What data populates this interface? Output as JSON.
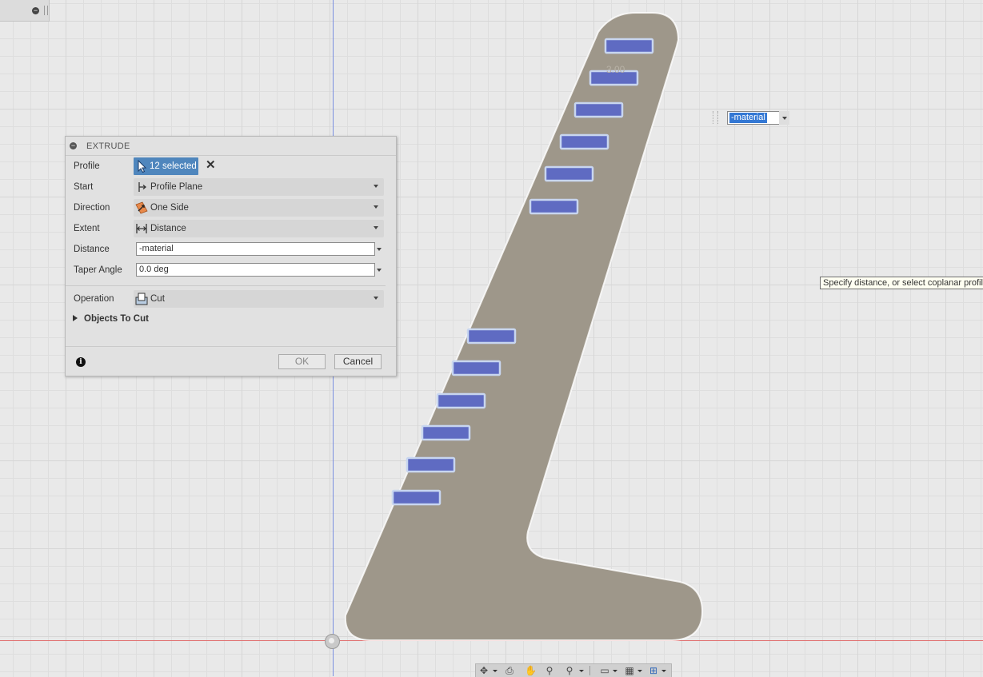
{
  "dialog": {
    "title": "EXTRUDE",
    "profile": {
      "label": "Profile",
      "value": "12 selected"
    },
    "start": {
      "label": "Start",
      "value": "Profile Plane"
    },
    "direction": {
      "label": "Direction",
      "value": "One Side"
    },
    "extent": {
      "label": "Extent",
      "value": "Distance"
    },
    "distance": {
      "label": "Distance",
      "value": "-material"
    },
    "taper": {
      "label": "Taper Angle",
      "value": "0.0 deg"
    },
    "operation": {
      "label": "Operation",
      "value": "Cut"
    },
    "objects_to_cut": "Objects To Cut",
    "ok_label": "OK",
    "cancel_label": "Cancel"
  },
  "canvas": {
    "inline_input_value": "-material",
    "tooltip": "Specify distance, or select coplanar profile",
    "part_color": "#9e978a",
    "slot_color": "#5f6bc2",
    "selection_outline": "#c8d6f0",
    "axis_x_color": "#e07070",
    "axis_y_color": "#7a8ee0"
  },
  "navbar": {
    "icons": [
      "orbit-icon",
      "look-at-icon",
      "pan-icon",
      "zoom-icon",
      "fit-icon",
      "display-settings-icon",
      "grid-settings-icon",
      "viewports-icon"
    ]
  }
}
